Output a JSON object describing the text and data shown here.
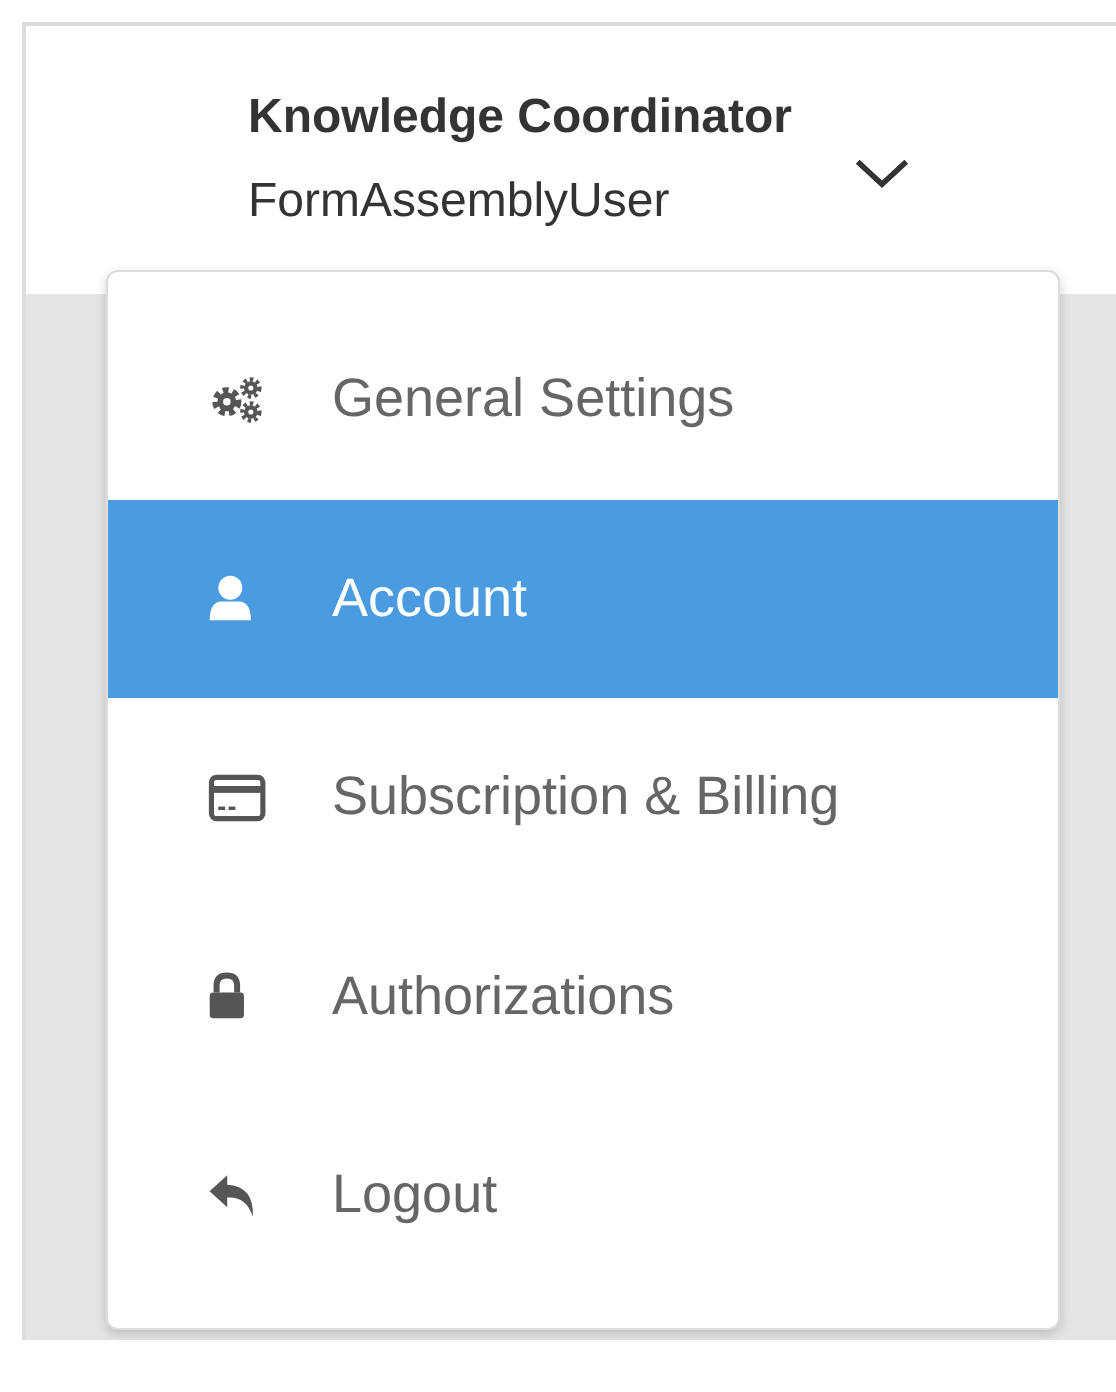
{
  "user_menu": {
    "name": "Knowledge Coordinator",
    "username": "FormAssemblyUser",
    "expanded": true
  },
  "menu_items": [
    {
      "label": "General Settings",
      "selected": false
    },
    {
      "label": "Account",
      "selected": true
    },
    {
      "label": "Subscription & Billing",
      "selected": false
    },
    {
      "label": "Authorizations",
      "selected": false
    },
    {
      "label": "Logout",
      "selected": false
    }
  ]
}
